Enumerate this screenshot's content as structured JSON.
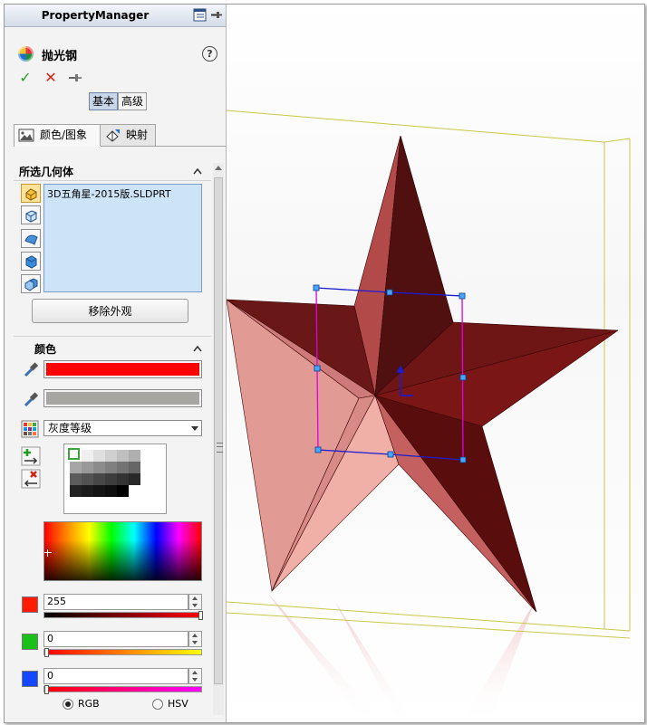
{
  "property_manager": {
    "title": "PropertyManager",
    "feature_name": "抛光钢",
    "help_symbol": "?",
    "confirm_symbol": "✓",
    "cancel_symbol": "✕",
    "pin_symbol": "⊣",
    "modes": [
      {
        "label": "基本",
        "active": true
      },
      {
        "label": "高级",
        "active": false
      }
    ],
    "tabs": [
      {
        "label": "颜色/图象",
        "active": true
      },
      {
        "label": "映射",
        "active": false
      }
    ]
  },
  "selected_geometry": {
    "title": "所选几何体",
    "filters": [
      "part-filter-icon",
      "body-filter-icon",
      "face-filter-icon",
      "feature-filter-icon",
      "component-filter-icon"
    ],
    "items": [
      "3D五角星-2015版.SLDPRT"
    ],
    "remove_button": "移除外观"
  },
  "color": {
    "title": "颜色",
    "primary_color": "#ff0000",
    "secondary_color": "#a8a6a2",
    "palette_select": "灰度等级",
    "gray_palette": [
      [
        "#ffffff",
        "#efefef",
        "#dfdfdf",
        "#cfcfcf",
        "#bfbfbf",
        "#afafaf"
      ],
      [
        "#a6a6a6",
        "#999999",
        "#8c8c8c",
        "#808080",
        "#737373",
        "#666666"
      ],
      [
        "#5c5c5c",
        "#525252",
        "#474747",
        "#3d3d3d",
        "#333333",
        "#292929"
      ],
      [
        "#222222",
        "#1b1b1b",
        "#141414",
        "#0e0e0e",
        "#000000",
        "#ffffff"
      ]
    ],
    "channels": [
      {
        "name": "red",
        "value": "255",
        "swatch": "#ff1a00",
        "bar_from": "#000000",
        "bar_to": "#ff0000",
        "level": 1.0
      },
      {
        "name": "green",
        "value": "0",
        "swatch": "#18c018",
        "bar_from": "#ff0000",
        "bar_to": "#ffff00",
        "level": 0.0
      },
      {
        "name": "blue",
        "value": "0",
        "swatch": "#1448ff",
        "bar_from": "#ff0000",
        "bar_to": "#ff00ff",
        "level": 0.0
      }
    ],
    "mode_options": [
      {
        "label": "RGB",
        "selected": true
      },
      {
        "label": "HSV",
        "selected": false
      }
    ]
  },
  "viewport": {
    "model": "3d-star",
    "star_color": "#8b1a1a",
    "bounding_box_color": "#c8c84a",
    "handle_box_color": "#1c1cd0",
    "handle_side_color": "#ff00ff"
  }
}
